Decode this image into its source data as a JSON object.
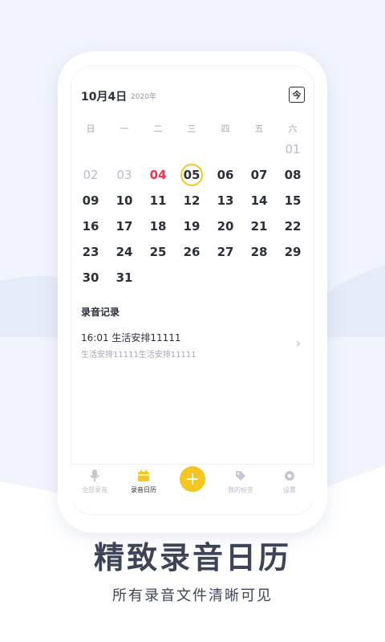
{
  "calendar": {
    "date_title": "10月4日",
    "year": "2020年",
    "today_icon_label": "今",
    "weekdays": [
      "日",
      "一",
      "二",
      "三",
      "四",
      "五",
      "六"
    ],
    "rows": [
      [
        "",
        "",
        "",
        "",
        "",
        "",
        "01"
      ],
      [
        "02",
        "03",
        "04",
        "05",
        "06",
        "07",
        "08"
      ],
      [
        "09",
        "10",
        "11",
        "12",
        "13",
        "14",
        "15"
      ],
      [
        "16",
        "17",
        "18",
        "19",
        "20",
        "21",
        "22"
      ],
      [
        "23",
        "24",
        "25",
        "26",
        "27",
        "28",
        "29"
      ],
      [
        "30",
        "31",
        "",
        "",
        "",
        "",
        ""
      ]
    ],
    "muted_days": [
      "01",
      "02",
      "03"
    ],
    "today_day": "04",
    "selected_day": "05"
  },
  "records": {
    "title": "录音记录",
    "items": [
      {
        "title": "16:01  生活安排11111",
        "subtitle": "生活安排11111生活安排11111"
      }
    ]
  },
  "tabbar": {
    "tabs": [
      {
        "label": "全部录音",
        "icon": "mic-icon"
      },
      {
        "label": "录音日历",
        "icon": "calendar-icon"
      },
      {
        "label": "我的标签",
        "icon": "tag-icon"
      },
      {
        "label": "设置",
        "icon": "gear-icon"
      }
    ],
    "fab_icon": "plus-icon",
    "active": "录音日历"
  },
  "promo": {
    "headline": "精致录音日历",
    "subline": "所有录音文件清晰可见"
  },
  "colors": {
    "accent": "#f5c622",
    "today": "#ee3552",
    "text": "#2b2f3a",
    "muted": "#b9bdc8"
  }
}
